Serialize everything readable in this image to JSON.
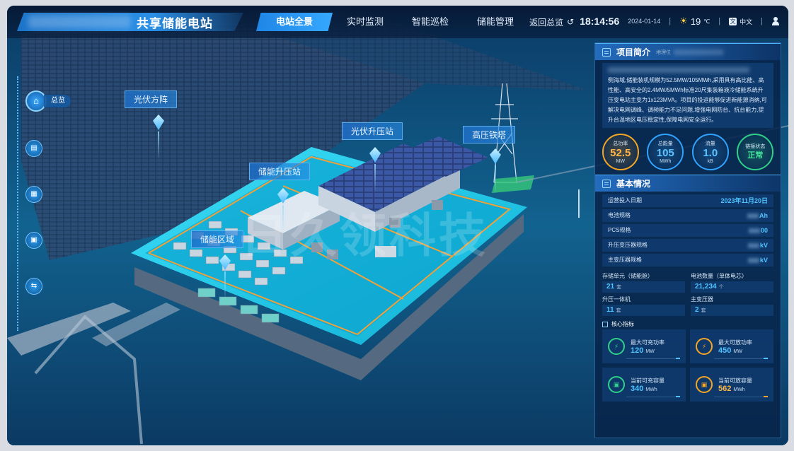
{
  "header": {
    "title": "共享储能电站",
    "tabs": [
      "电站全景",
      "实时监测",
      "智能巡检",
      "储能管理"
    ],
    "active_tab": "电站全景",
    "back_label": "返回总览",
    "time": "18:14:56",
    "date": "2024-01-14",
    "temperature": "19",
    "temperature_unit": "℃",
    "language": "中文",
    "icons": [
      "sun-icon",
      "language-icon",
      "user-icon",
      "return-icon"
    ]
  },
  "left_rail": {
    "overview_label": "总览",
    "buttons": [
      "overview",
      "layer",
      "calendar",
      "battery",
      "switch"
    ]
  },
  "scene": {
    "labels": {
      "pv_array": "光伏方阵",
      "pv_substation": "光伏升压站",
      "storage_substation": "储能升压站",
      "hv_tower": "高压铁塔",
      "storage_area": "储能区域"
    },
    "watermark": "日久领科技"
  },
  "project_intro": {
    "title": "项目简介",
    "subtitle": "地理位",
    "text": "侧海域,储能装机规模为52.5MW/105MWh,采用具有高比能、高性能、高安全的2.4MW/5MWh标准20尺集装箱液冷储能系统升压变电站主变为1x123MVA。项目的投运能够促进新能源消纳,可解决电网调峰、调频能力不足问题,增强电网防台、抗台能力,提升台温地区电压稳定性,保障电网安全运行。",
    "metrics": [
      {
        "label": "总功率",
        "value": "52.5",
        "unit": "MW",
        "color": "#f5a623"
      },
      {
        "label": "总能量",
        "value": "105",
        "unit": "MWh",
        "color": "#2fa3ff"
      },
      {
        "label": "流量",
        "value": "1.0",
        "unit": "kB",
        "color": "#2fa3ff"
      },
      {
        "label": "链接状态",
        "value": "正常",
        "unit": "",
        "color": "#2fd18a"
      }
    ]
  },
  "basic_info": {
    "title": "基本情况",
    "rows": [
      {
        "label": "运营投入日期",
        "value": "2023年11月20日"
      },
      {
        "label": "电池规格",
        "value": "Ah"
      },
      {
        "label": "PCS规格",
        "value": "00"
      },
      {
        "label": "升压变压器规格",
        "value": "kV"
      },
      {
        "label": "主变压器规格",
        "value": "kV"
      }
    ],
    "grid": [
      {
        "label": "存储单元（储能舱）",
        "value": "21",
        "unit": "套"
      },
      {
        "label": "电池数量（单体电芯）",
        "value": "21,234",
        "unit": "个"
      },
      {
        "label": "升压一体机",
        "value": "11",
        "unit": "套"
      },
      {
        "label": "主变压器",
        "value": "2",
        "unit": "套"
      }
    ],
    "core_title": "核心指标",
    "cards": [
      {
        "label": "最大可充功率",
        "value": "120",
        "unit": "MW",
        "color": "#2fd18a"
      },
      {
        "label": "最大可放功率",
        "value": "450",
        "unit": "MW",
        "color": "#f5a623"
      },
      {
        "label": "当前可充容量",
        "value": "340",
        "unit": "MWh",
        "color": "#2fd18a"
      },
      {
        "label": "当前可放容量",
        "value": "562",
        "unit": "MWh",
        "color": "#f5a623"
      }
    ]
  }
}
